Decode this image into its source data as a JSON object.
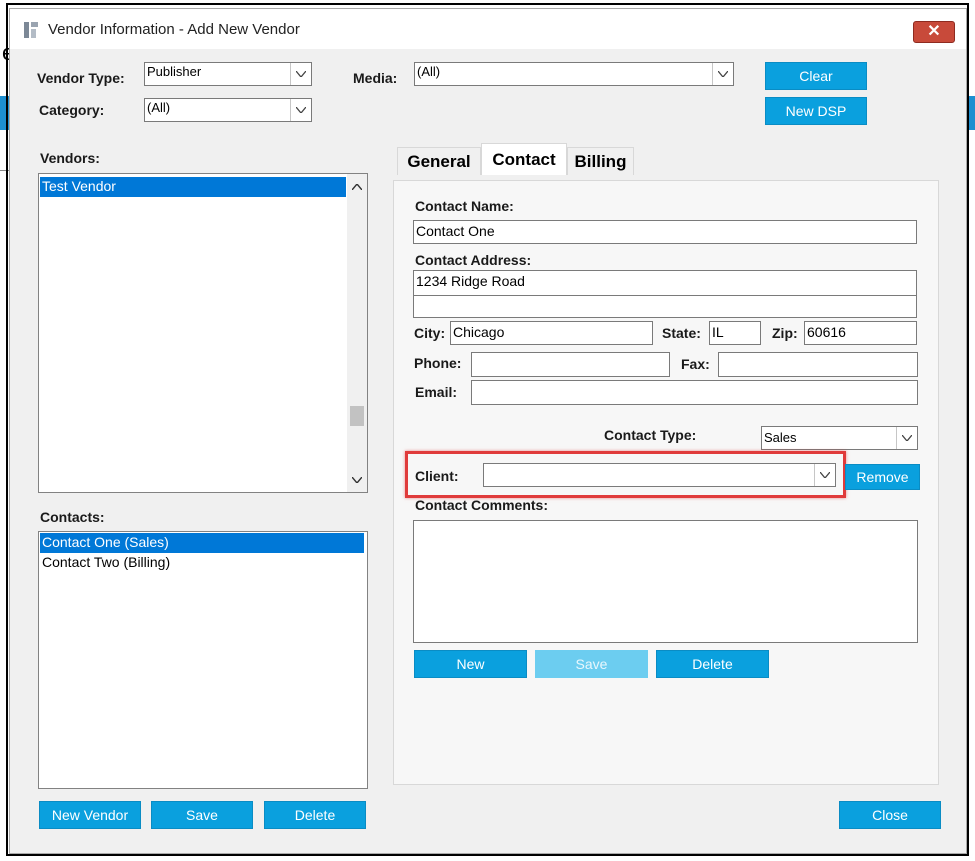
{
  "window": {
    "title": "Vendor Information - Add New Vendor",
    "close_glyph": "✕"
  },
  "filters": {
    "vendor_type_label": "Vendor Type:",
    "vendor_type_value": "Publisher",
    "category_label": "Category:",
    "category_value": "(All)",
    "media_label": "Media:",
    "media_value": "(All)"
  },
  "buttons": {
    "clear": "Clear",
    "new_dsp": "New DSP",
    "new_vendor": "New Vendor",
    "save_vendor": "Save",
    "delete_vendor": "Delete",
    "close": "Close",
    "contact_new": "New",
    "contact_save": "Save",
    "contact_delete": "Delete",
    "remove": "Remove"
  },
  "vendors": {
    "label": "Vendors:",
    "items": [
      "Test Vendor"
    ]
  },
  "contacts": {
    "label": "Contacts:",
    "items": [
      "Contact One (Sales)",
      "Contact Two (Billing)"
    ]
  },
  "tabs": [
    "General",
    "Contact",
    "Billing"
  ],
  "contact_form": {
    "name_label": "Contact Name:",
    "name_value": "Contact One",
    "address_label": "Contact Address:",
    "address_line1": "1234 Ridge Road",
    "address_line2": "",
    "city_label": "City:",
    "city_value": "Chicago",
    "state_label": "State:",
    "state_value": "IL",
    "zip_label": "Zip:",
    "zip_value": "60616",
    "phone_label": "Phone:",
    "phone_value": "",
    "fax_label": "Fax:",
    "fax_value": "",
    "email_label": "Email:",
    "email_value": "",
    "contact_type_label": "Contact Type:",
    "contact_type_value": "Sales",
    "client_label": "Client:",
    "client_value": "",
    "comments_label": "Contact Comments:",
    "comments_value": ""
  },
  "colors": {
    "accent": "#0aa0de",
    "selection": "#0078d7",
    "highlight": "#e03b3b"
  }
}
